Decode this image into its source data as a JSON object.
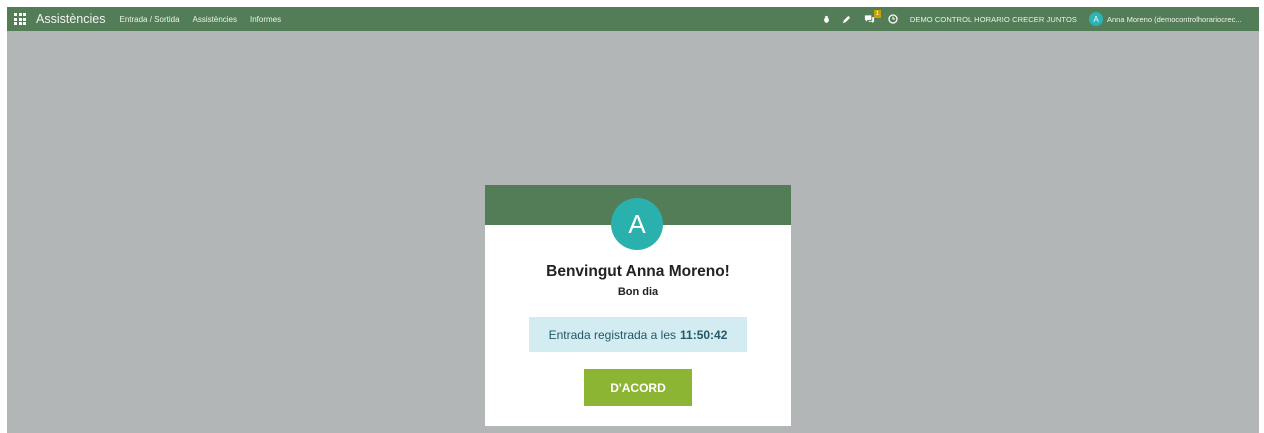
{
  "navbar": {
    "app_title": "Assistències",
    "menu": [
      {
        "label": "Entrada / Sortida"
      },
      {
        "label": "Assistències"
      },
      {
        "label": "Informes"
      }
    ],
    "chat_badge": "1",
    "company": "DEMO CONTROL HORARIO CRECER JUNTOS",
    "user": {
      "initial": "A",
      "name": "Anna Moreno (democontrolhorariocrec..."
    },
    "icons": [
      "apps-grid-icon",
      "bug-icon",
      "edit-icon",
      "chat-icon",
      "clock-icon"
    ]
  },
  "dialog": {
    "avatar_initial": "A",
    "welcome": "Benvingut Anna Moreno!",
    "greeting": "Bon dia",
    "checkin_text": "Entrada registrada a les",
    "checkin_time": "11:50:42",
    "ok_label": "D'ACORD"
  },
  "colors": {
    "navbar": "#537d57",
    "backdrop": "#b2b6b6",
    "avatar": "#2ab0ad",
    "alert_bg": "#d2ecf1",
    "button": "#8db534"
  }
}
